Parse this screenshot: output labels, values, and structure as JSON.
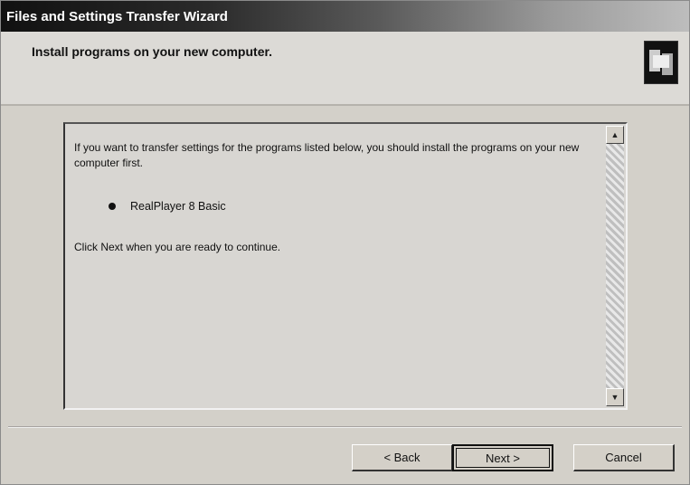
{
  "window": {
    "title": "Files and Settings Transfer Wizard"
  },
  "header": {
    "title": "Install programs on your new computer.",
    "logo_icon": "wizard-logo-icon"
  },
  "content": {
    "intro": "If you want to transfer settings for the programs listed below, you should install the programs on your new computer first.",
    "programs": [
      "RealPlayer 8 Basic"
    ],
    "instruction": "Click Next when you are ready to continue."
  },
  "scrollbar": {
    "up_icon": "scroll-up-arrow-icon",
    "down_icon": "scroll-down-arrow-icon"
  },
  "buttons": {
    "back": "< Back",
    "next": "Next >",
    "cancel": "Cancel"
  }
}
